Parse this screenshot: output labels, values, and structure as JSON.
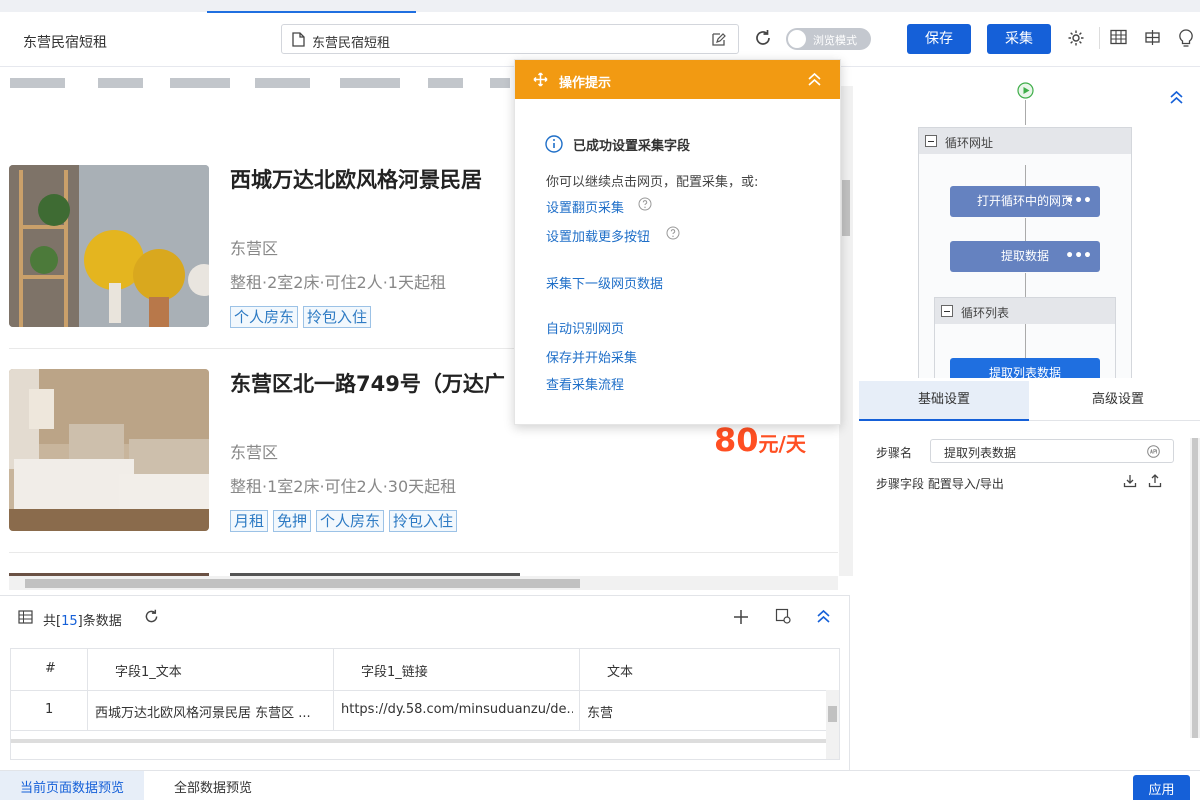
{
  "toolbar": {
    "tab_title": "东营民宿短租",
    "url": "东营民宿短租",
    "browse_mode": "浏览模式",
    "save": "保存",
    "collect": "采集"
  },
  "listings": [
    {
      "title": "西城万达北欧风格河景民居",
      "district": "东营区",
      "info": "整租·2室2床·可住2人·1天起租",
      "tags": [
        "个人房东",
        "拎包入住"
      ]
    },
    {
      "title": "东营区北一路749号（万达广",
      "district": "东营区",
      "info": "整租·1室2床·可住2人·30天起租",
      "tags": [
        "月租",
        "免押",
        "个人房东",
        "拎包入住"
      ],
      "price": "80",
      "price_unit": "元/天"
    }
  ],
  "tips": {
    "title": "操作提示",
    "success": "已成功设置采集字段",
    "desc": "你可以继续点击网页，配置采集，或:",
    "links": [
      "设置翻页采集",
      "设置加载更多按钮",
      "采集下一级网页数据",
      "自动识别网页",
      "保存并开始采集",
      "查看采集流程"
    ]
  },
  "workflow": {
    "loop_url": "循环网址",
    "open_page": "打开循环中的网页",
    "extract": "提取数据",
    "loop_list": "循环列表",
    "extract_list": "提取列表数据",
    "more": "•••"
  },
  "settings": {
    "tab_basic": "基础设置",
    "tab_advanced": "高级设置",
    "step_name_label": "步骤名",
    "step_name_value": "提取列表数据",
    "step_fields_label": "步骤字段 配置导入/导出"
  },
  "data_panel": {
    "count_prefix": "共[",
    "count": "15",
    "count_suffix": "]条数据",
    "headers": [
      "#",
      "字段1_文本",
      "字段1_链接",
      "文本"
    ],
    "rows": [
      [
        "1",
        "西城万达北欧风格河景民居 东营区 ...",
        "https://dy.58.com/minsuduanzu/de...",
        "东营"
      ]
    ],
    "tab_current": "当前页面数据预览",
    "tab_all": "全部数据预览",
    "apply": "应用"
  }
}
